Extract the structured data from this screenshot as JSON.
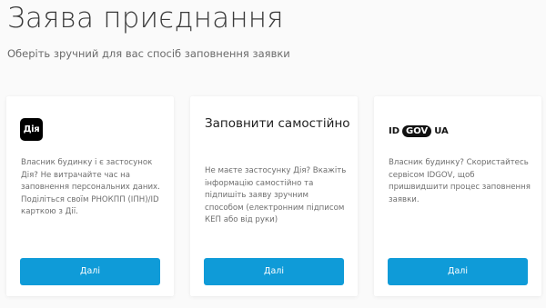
{
  "page": {
    "title": "Заява приєднання",
    "subtitle": "Оберіть зручний для вас спосіб заповнення заявки"
  },
  "cards": [
    {
      "logo_text": "Дія",
      "description": "Власник будинку і є застосунок Дія? Не витрачайте час на заповнення персональних даних. Поділіться своїм РНОКПП (ІПН)/ID карткою з Дії.",
      "button_label": "Далі"
    },
    {
      "heading": "Заповнити самостійно",
      "description": "Не маєте застосунку Дія? Вкажіть інформацію самостійно та підпишіть заяву зручним способом (електронним підписом КЕП або від руки)",
      "button_label": "Далі"
    },
    {
      "logo_parts": [
        "ID",
        "GOV",
        "UA"
      ],
      "description": "Власник будинку? Скористайтесь сервісом IDGOV, щоб пришвидшити процес заповнення заявки.",
      "button_label": "Далі"
    }
  ],
  "colors": {
    "primary_button": "#0f9bd8",
    "background": "#fafafa",
    "card": "#ffffff"
  }
}
